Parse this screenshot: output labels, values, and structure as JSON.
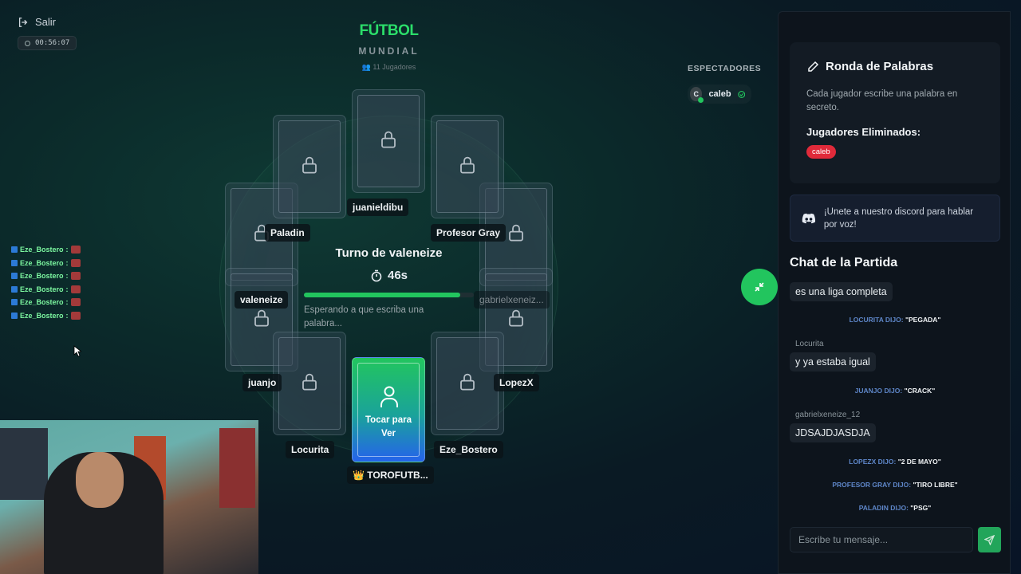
{
  "exit": {
    "label": "Salir"
  },
  "timer": {
    "value": "00:56:07"
  },
  "feed": [
    {
      "name": "Eze_Bostero",
      "sep": ":"
    },
    {
      "name": "Eze_Bostero",
      "sep": ":"
    },
    {
      "name": "Eze_Bostero",
      "sep": ":"
    },
    {
      "name": "Eze_Bostero",
      "sep": ":"
    },
    {
      "name": "Eze_Bostero",
      "sep": ":"
    },
    {
      "name": "Eze_Bostero",
      "sep": ":"
    }
  ],
  "game": {
    "title": "FÚTBOL",
    "subtitle": "MUNDIAL",
    "players_count": "11 Jugadores"
  },
  "players": {
    "juanieldibu": "juanieldibu",
    "paladin": "Paladin",
    "profesor_gray": "Profesor Gray",
    "valeneize": "valeneize",
    "gabrielxeneize": "gabrielxeneiz...",
    "juanjo": "juanjo",
    "lopezx": "LopezX",
    "locurita": "Locurita",
    "eze_bostero": "Eze_Bostero",
    "me": "👑 TOROFUTB..."
  },
  "turn": {
    "title": "Turno de valeneize",
    "seconds": "46s",
    "progress": 0.92,
    "waiting": "Esperando a que escriba una palabra..."
  },
  "me_card": {
    "line1": "Tocar para",
    "line2": "Ver"
  },
  "spectators": {
    "heading": "ESPECTADORES",
    "users": [
      {
        "initial": "C",
        "name": "caleb"
      }
    ]
  },
  "round_panel": {
    "title": "Ronda de Palabras",
    "description": "Cada jugador escribe una palabra en secreto.",
    "eliminated_heading": "Jugadores Eliminados:",
    "eliminated": [
      "caleb"
    ]
  },
  "discord": {
    "text": "¡Unete a nuestro discord para hablar por voz!"
  },
  "chat": {
    "title": "Chat de la Partida",
    "messages": [
      {
        "kind": "bubble",
        "author": "",
        "text": "es una liga completa"
      },
      {
        "kind": "system",
        "player": "LOCURITA",
        "said": "DIJO:",
        "word": "\"PEGADA\""
      },
      {
        "kind": "bubble",
        "author": "Locurita",
        "text": "y ya estaba igual"
      },
      {
        "kind": "system",
        "player": "JUANJO",
        "said": "DIJO:",
        "word": "\"CRACK\""
      },
      {
        "kind": "bubble",
        "author": "gabrielxeneize_12",
        "text": "JDSAJDJASDJA"
      },
      {
        "kind": "system",
        "player": "LOPEZX",
        "said": "DIJO:",
        "word": "\"2 DE MAYO\""
      },
      {
        "kind": "system",
        "player": "PROFESOR GRAY",
        "said": "DIJO:",
        "word": "\"TIRO LIBRE\""
      },
      {
        "kind": "system",
        "player": "PALADIN",
        "said": "DIJO:",
        "word": "\"PSG\""
      }
    ],
    "input_placeholder": "Escribe tu mensaje..."
  },
  "colors": {
    "accent": "#22c55e",
    "danger": "#e02a3a",
    "system_text": "#5e86c8"
  }
}
